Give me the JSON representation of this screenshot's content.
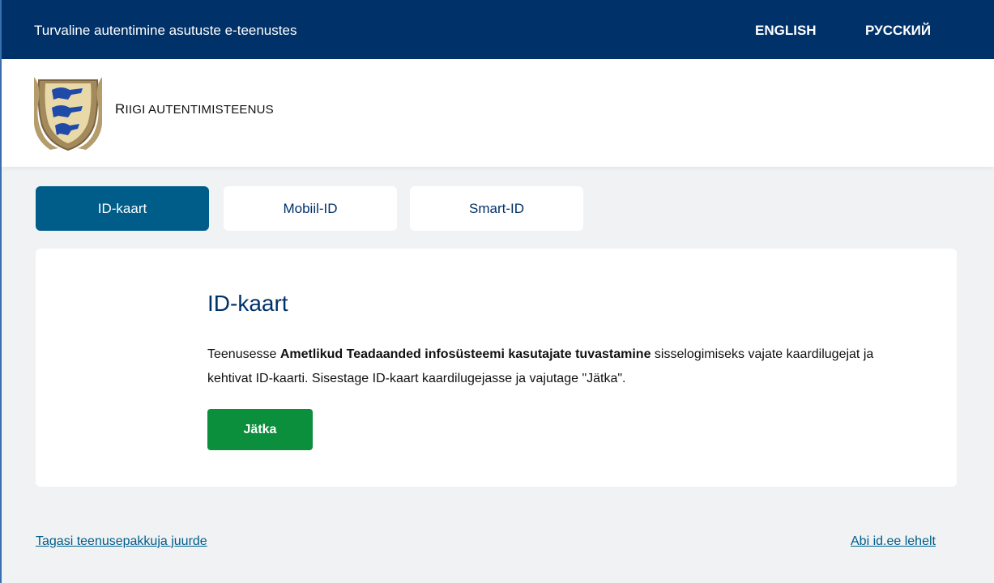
{
  "topbar": {
    "title": "Turvaline autentimine asutuste e-teenustes",
    "languages": [
      "ENGLISH",
      "РУССКИЙ"
    ]
  },
  "header": {
    "brand_first": "R",
    "brand_rest": "IIGI AUTENTIMISTEENUS"
  },
  "tabs": [
    {
      "label": "ID-kaart",
      "active": true
    },
    {
      "label": "Mobiil-ID",
      "active": false
    },
    {
      "label": "Smart-ID",
      "active": false
    }
  ],
  "card": {
    "title": "ID-kaart",
    "text_before": "Teenusesse ",
    "text_bold": "Ametlikud Teadaanded infosüsteemi kasutajate tuvastamine",
    "text_after": " sisselogimiseks vajate kaardilugejat ja kehtivat ID-kaarti. Sisestage ID-kaart kaardilugejasse ja vajutage \"Jätka\".",
    "button_label": "Jätka"
  },
  "footer": {
    "back_link": "Tagasi teenusepakkuja juurde",
    "help_link": "Abi id.ee lehelt"
  },
  "colors": {
    "topbar": "#003168",
    "tab_active": "#005d8a",
    "button": "#0c8f3c",
    "background": "#f0f2f4"
  }
}
